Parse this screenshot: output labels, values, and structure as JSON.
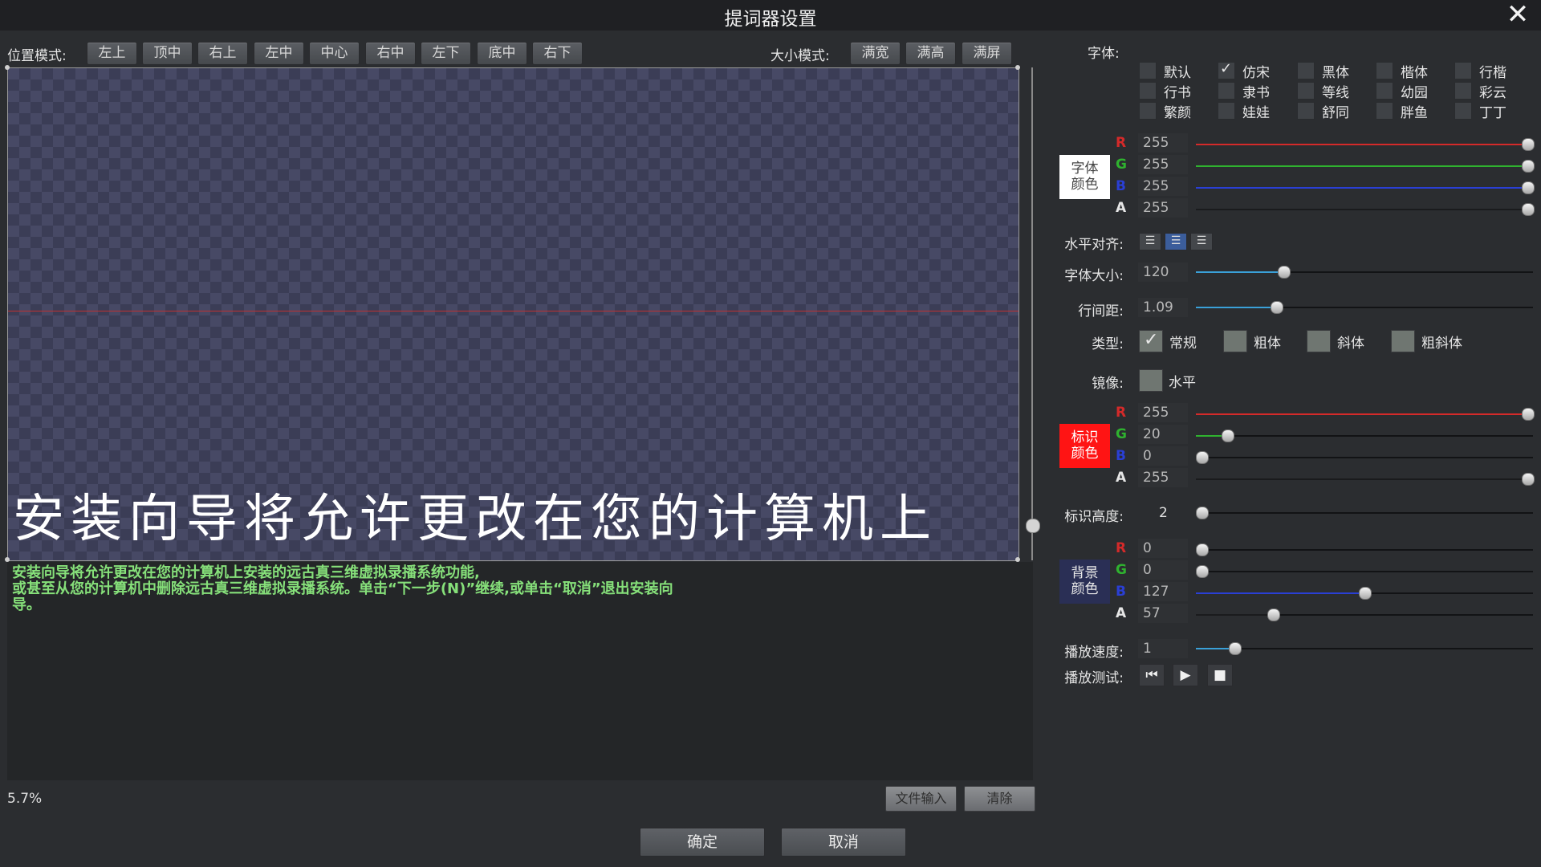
{
  "window": {
    "title": "提词器设置",
    "close_label": "✕"
  },
  "position_mode": {
    "label": "位置模式:",
    "buttons": [
      "左上",
      "顶中",
      "右上",
      "左中",
      "中心",
      "右中",
      "左下",
      "底中",
      "右下"
    ]
  },
  "size_mode": {
    "label": "大小模式:",
    "buttons": [
      "满宽",
      "满高",
      "满屏"
    ]
  },
  "preview": {
    "text": "安装向导将允许更改在您的计算机上"
  },
  "editor": {
    "lines": [
      "安装向导将允许更改在您的计算机上安装的远古真三维虚拟录播系统功能,",
      "或甚至从您的计算机中删除远古真三维虚拟录播系统。单击“下一步(N)”继续,或单击“取消”退出安装向",
      "导。"
    ]
  },
  "progress_percent": "5.7%",
  "file_input_label": "文件输入",
  "clear_label": "清除",
  "ok_label": "确定",
  "cancel_label": "取消",
  "font": {
    "label": "字体:",
    "options": [
      {
        "name": "默认",
        "checked": false
      },
      {
        "name": "仿宋",
        "checked": true
      },
      {
        "name": "黑体",
        "checked": false
      },
      {
        "name": "楷体",
        "checked": false
      },
      {
        "name": "行楷",
        "checked": false
      },
      {
        "name": "行书",
        "checked": false
      },
      {
        "name": "隶书",
        "checked": false
      },
      {
        "name": "等线",
        "checked": false
      },
      {
        "name": "幼园",
        "checked": false
      },
      {
        "name": "彩云",
        "checked": false
      },
      {
        "name": "繁颜",
        "checked": false
      },
      {
        "name": "娃娃",
        "checked": false
      },
      {
        "name": "舒同",
        "checked": false
      },
      {
        "name": "胖鱼",
        "checked": false
      },
      {
        "name": "丁丁",
        "checked": false
      }
    ]
  },
  "font_color": {
    "label": "字体\n颜色",
    "swatch": "#ffffff",
    "channels": [
      {
        "ch": "R",
        "value": "255",
        "color": "#d42a2a",
        "level": 1.0
      },
      {
        "ch": "G",
        "value": "255",
        "color": "#2fb22f",
        "level": 1.0
      },
      {
        "ch": "B",
        "value": "255",
        "color": "#2a3fd4",
        "level": 1.0
      },
      {
        "ch": "A",
        "value": "255",
        "color": "#e6e6e6",
        "level": 1.0
      }
    ]
  },
  "h_align": {
    "label": "水平对齐:",
    "active": 1
  },
  "font_size": {
    "label": "字体大小:",
    "value": "120",
    "level": 0.25
  },
  "line_spacing": {
    "label": "行间距:",
    "value": "1.09",
    "level": 0.23
  },
  "style_type": {
    "label": "类型:",
    "options": [
      {
        "name": "常规",
        "checked": true
      },
      {
        "name": "粗体",
        "checked": false
      },
      {
        "name": "斜体",
        "checked": false
      },
      {
        "name": "粗斜体",
        "checked": false
      }
    ]
  },
  "mirror": {
    "label": "镜像:",
    "option": "水平",
    "checked": false
  },
  "mark_color": {
    "label": "标识\n颜色",
    "swatch": "#ff1414",
    "channels": [
      {
        "ch": "R",
        "value": "255",
        "color": "#d42a2a",
        "level": 1.0
      },
      {
        "ch": "G",
        "value": "20",
        "color": "#2fb22f",
        "level": 0.08
      },
      {
        "ch": "B",
        "value": "0",
        "color": "#2a3fd4",
        "level": 0.0
      },
      {
        "ch": "A",
        "value": "255",
        "color": "#e6e6e6",
        "level": 1.0
      }
    ]
  },
  "mark_height": {
    "label": "标识高度:",
    "value": "2",
    "level": 0.0
  },
  "bg_color": {
    "label": "背景\n颜色",
    "swatch": "#2a2f55",
    "channels": [
      {
        "ch": "R",
        "value": "0",
        "color": "#d42a2a",
        "level": 0.0
      },
      {
        "ch": "G",
        "value": "0",
        "color": "#2fb22f",
        "level": 0.0
      },
      {
        "ch": "B",
        "value": "127",
        "color": "#2a3fd4",
        "level": 0.5
      },
      {
        "ch": "A",
        "value": "57",
        "color": "#e6e6e6",
        "level": 0.22
      }
    ]
  },
  "play_speed": {
    "label": "播放速度:",
    "value": "1",
    "level": 0.1
  },
  "play_test": {
    "label": "播放测试:",
    "icons": [
      "skip-back-icon",
      "play-icon",
      "stop-icon"
    ]
  }
}
